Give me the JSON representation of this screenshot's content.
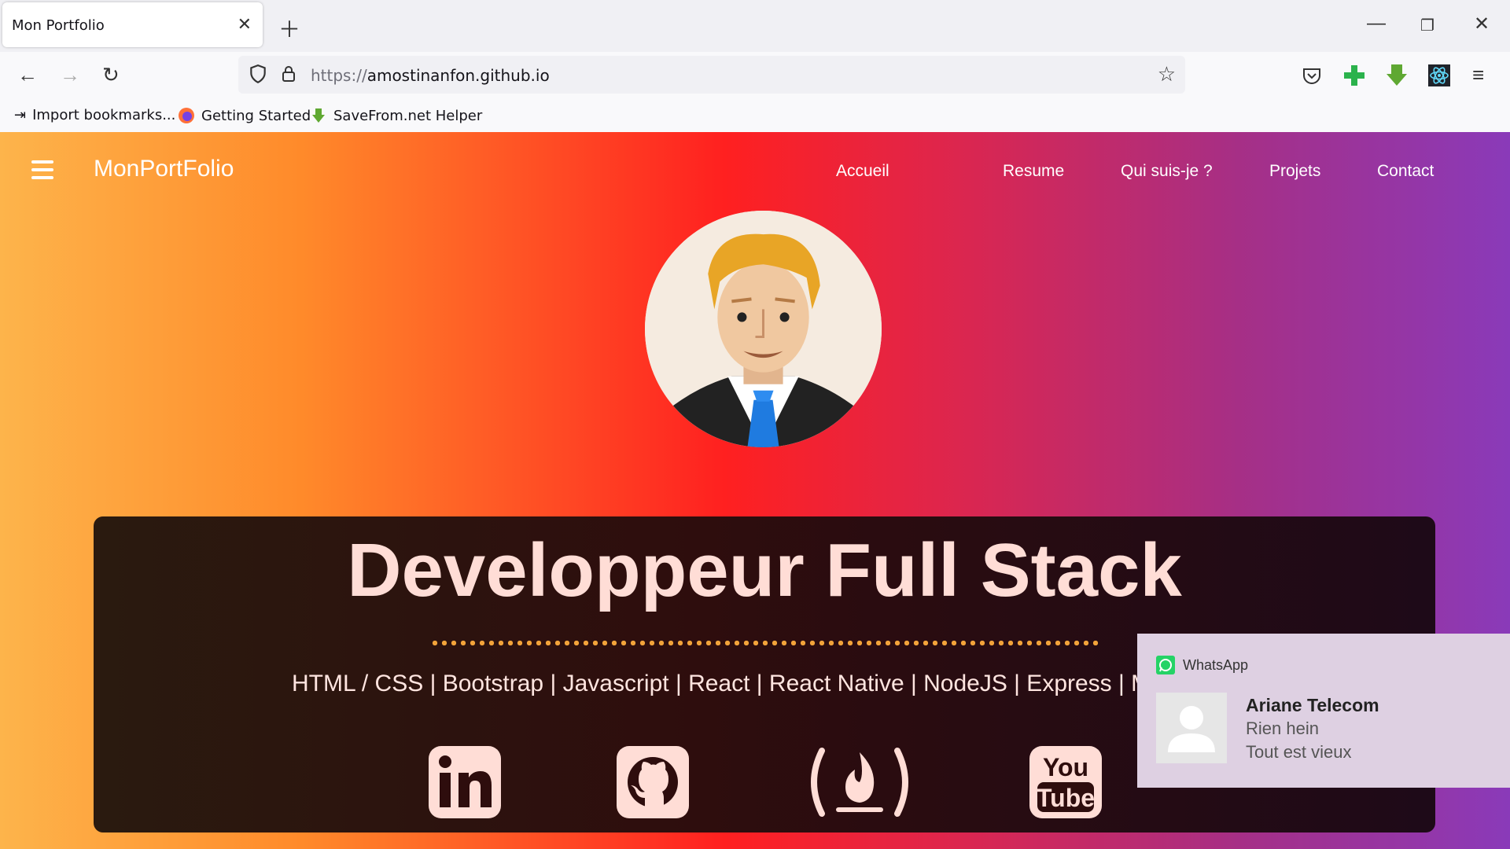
{
  "browser": {
    "tab_title": "Mon Portfolio",
    "url_scheme": "https://",
    "url_host": "amostinanfon.github.io",
    "bookmarks": [
      "Import bookmarks...",
      "Getting Started",
      "SaveFrom.net Helper"
    ]
  },
  "site": {
    "brand": "MonPortFolio",
    "nav": [
      "Accueil",
      "Resume",
      "Qui suis-je ?",
      "Projets",
      "Contact"
    ],
    "headline": "Developpeur Full Stack",
    "skills": "HTML / CSS | Bootstrap | Javascript | React | React Native | NodeJS | Express | M",
    "social": [
      "linkedin-icon",
      "github-icon",
      "freecodecamp-icon",
      "youtube-icon"
    ]
  },
  "notification": {
    "app": "WhatsApp",
    "sender": "Ariane Telecom",
    "line1": "Rien hein",
    "line2": "Tout est vieux"
  },
  "colors": {
    "gradient": [
      "#fdb44b",
      "#ff2020",
      "#8a3ab9"
    ],
    "headline": "#ffddd6",
    "dots": "#f2a33a",
    "whatsapp": "#25d366"
  }
}
